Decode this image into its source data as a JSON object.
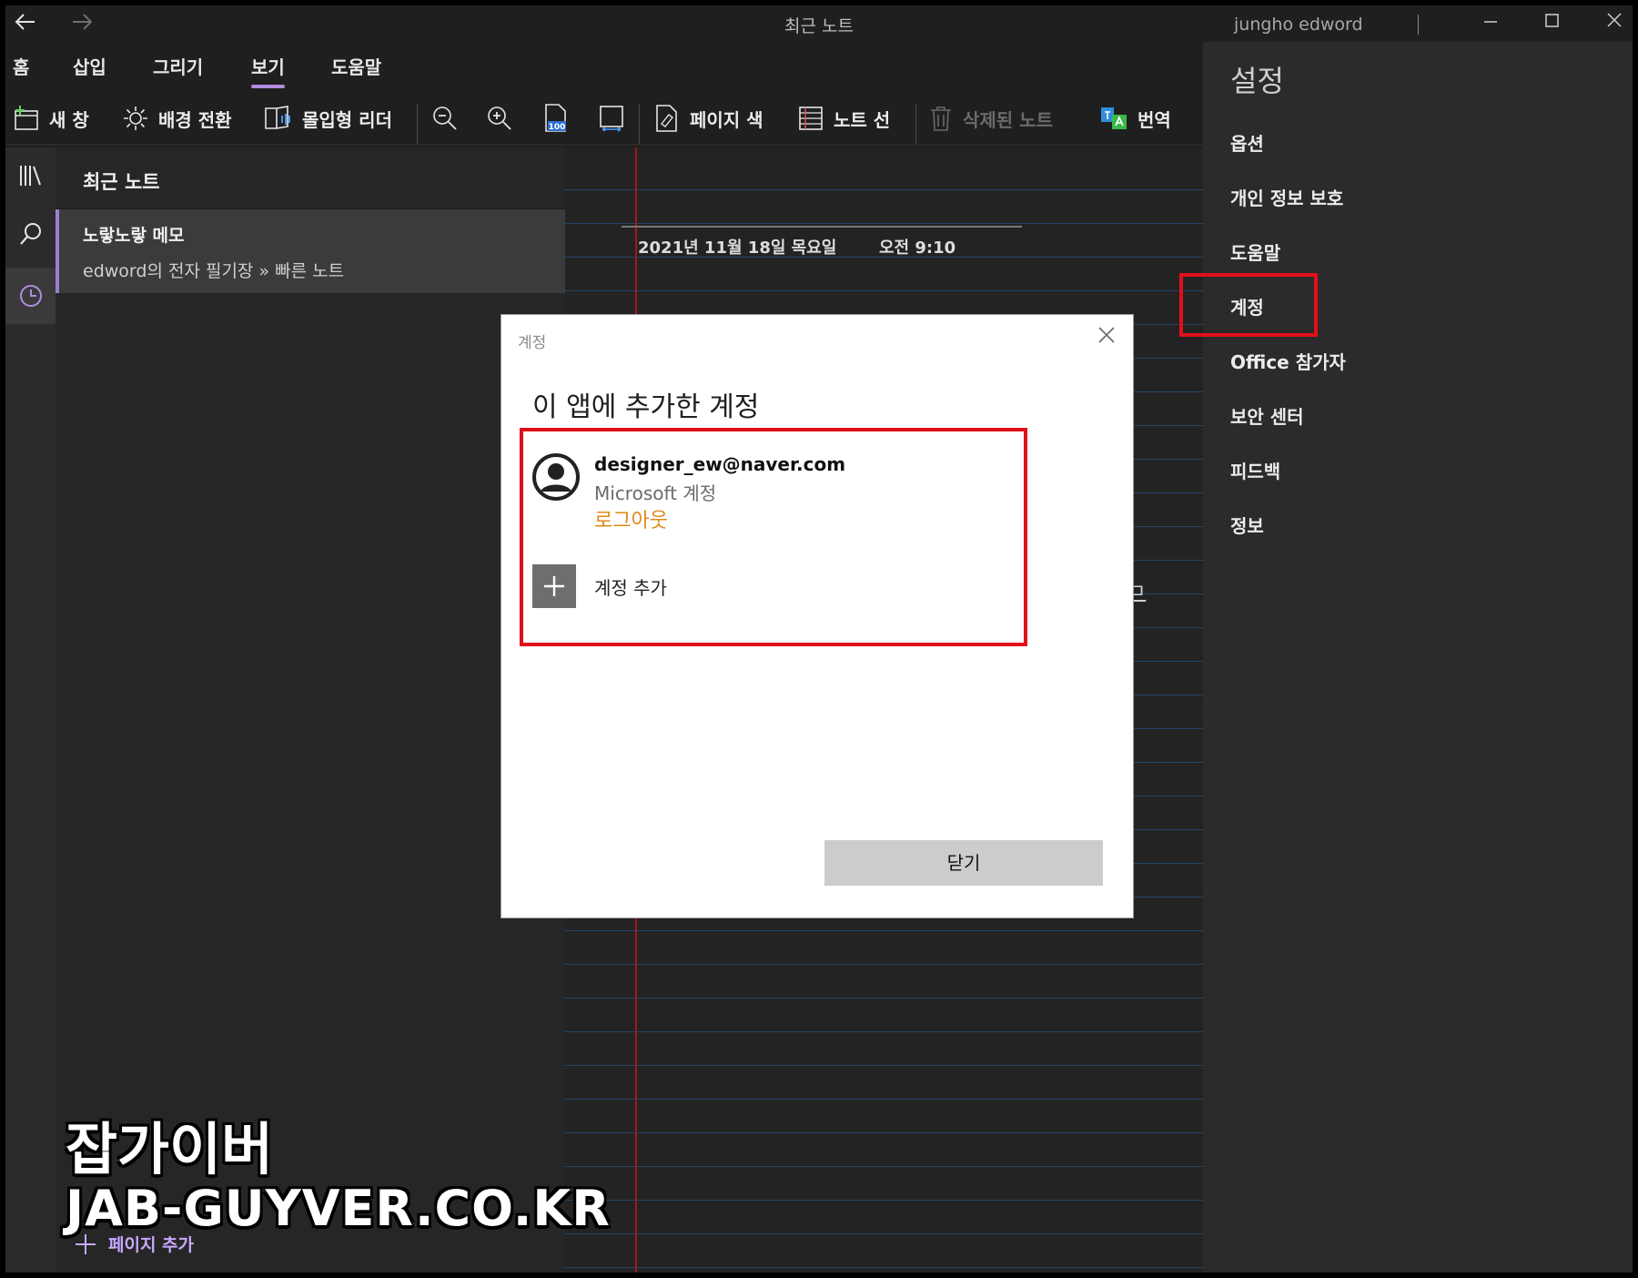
{
  "window": {
    "title": "최근 노트",
    "user": "jungho edword"
  },
  "ribbon": {
    "tabs": [
      {
        "label": "홈",
        "active": false
      },
      {
        "label": "삽입",
        "active": false
      },
      {
        "label": "그리기",
        "active": false
      },
      {
        "label": "보기",
        "active": true
      },
      {
        "label": "도움말",
        "active": false
      }
    ],
    "tools": {
      "new_window": "새 창",
      "switch_background": "배경 전환",
      "immersive_reader": "몰입형 리더",
      "page_color": "페이지 색",
      "note_lines": "노트 선",
      "deleted_notes": "삭제된 노트",
      "translate": "번역",
      "zoom_badge": "100"
    }
  },
  "notelist": {
    "header": "최근 노트",
    "items": [
      {
        "title": "노랗노랗 메모",
        "subtitle": "edword의 전자 필기장 » 빠른 노트"
      }
    ],
    "add_page": "페이지 추가"
  },
  "canvas": {
    "date": "2021년 11월 18일 목요일",
    "time": "오전 9:10",
    "fragment": "ㅁ"
  },
  "settings": {
    "title": "설정",
    "items": [
      "옵션",
      "개인 정보 보호",
      "도움말",
      "계정",
      "Office 참가자",
      "보안 센터",
      "피드백",
      "정보"
    ],
    "highlighted": "계정"
  },
  "dialog": {
    "caption": "계정",
    "heading": "이 앱에 추가한 계정",
    "account": {
      "email": "designer_ew@naver.com",
      "type": "Microsoft 계정",
      "logout": "로그아웃"
    },
    "add_account": "계정 추가",
    "close_button": "닫기"
  },
  "watermark": {
    "line1": "잡가이버",
    "line2": "JAB-GUYVER.CO.KR"
  },
  "colors": {
    "accent": "#b18ce0",
    "highlight_box": "#e0101a",
    "logout_link": "#e08a1a"
  }
}
